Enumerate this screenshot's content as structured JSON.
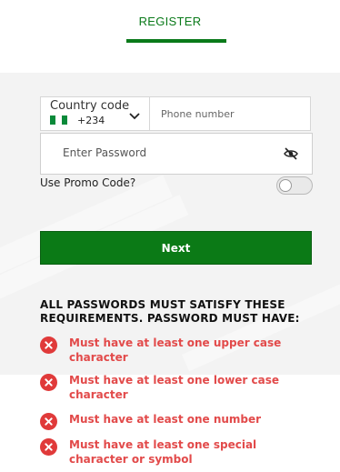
{
  "header": {
    "tab_label": "REGISTER",
    "accent_color": "#0a7a1a"
  },
  "phone": {
    "country_code_label": "Country code",
    "country_flag": "nigeria-flag",
    "dial_code": "+234",
    "placeholder": "Phone number"
  },
  "password": {
    "placeholder": "Enter Password",
    "visibility_icon": "eye-slash-icon"
  },
  "promo": {
    "label": "Use Promo Code?",
    "toggle_on": false
  },
  "next_button": {
    "label": "Next",
    "color": "#0b7a16"
  },
  "requirements": {
    "title": "ALL PASSWORDS MUST SATISFY THESE REQUIREMENTS. PASSWORD MUST HAVE:",
    "status_icon": "error-x-icon",
    "error_color": "#e24a4a",
    "items": [
      "Must have at least one upper case character",
      "Must have at least one lower case character",
      "Must have at least one number",
      "Must have at least one special character or symbol"
    ]
  }
}
